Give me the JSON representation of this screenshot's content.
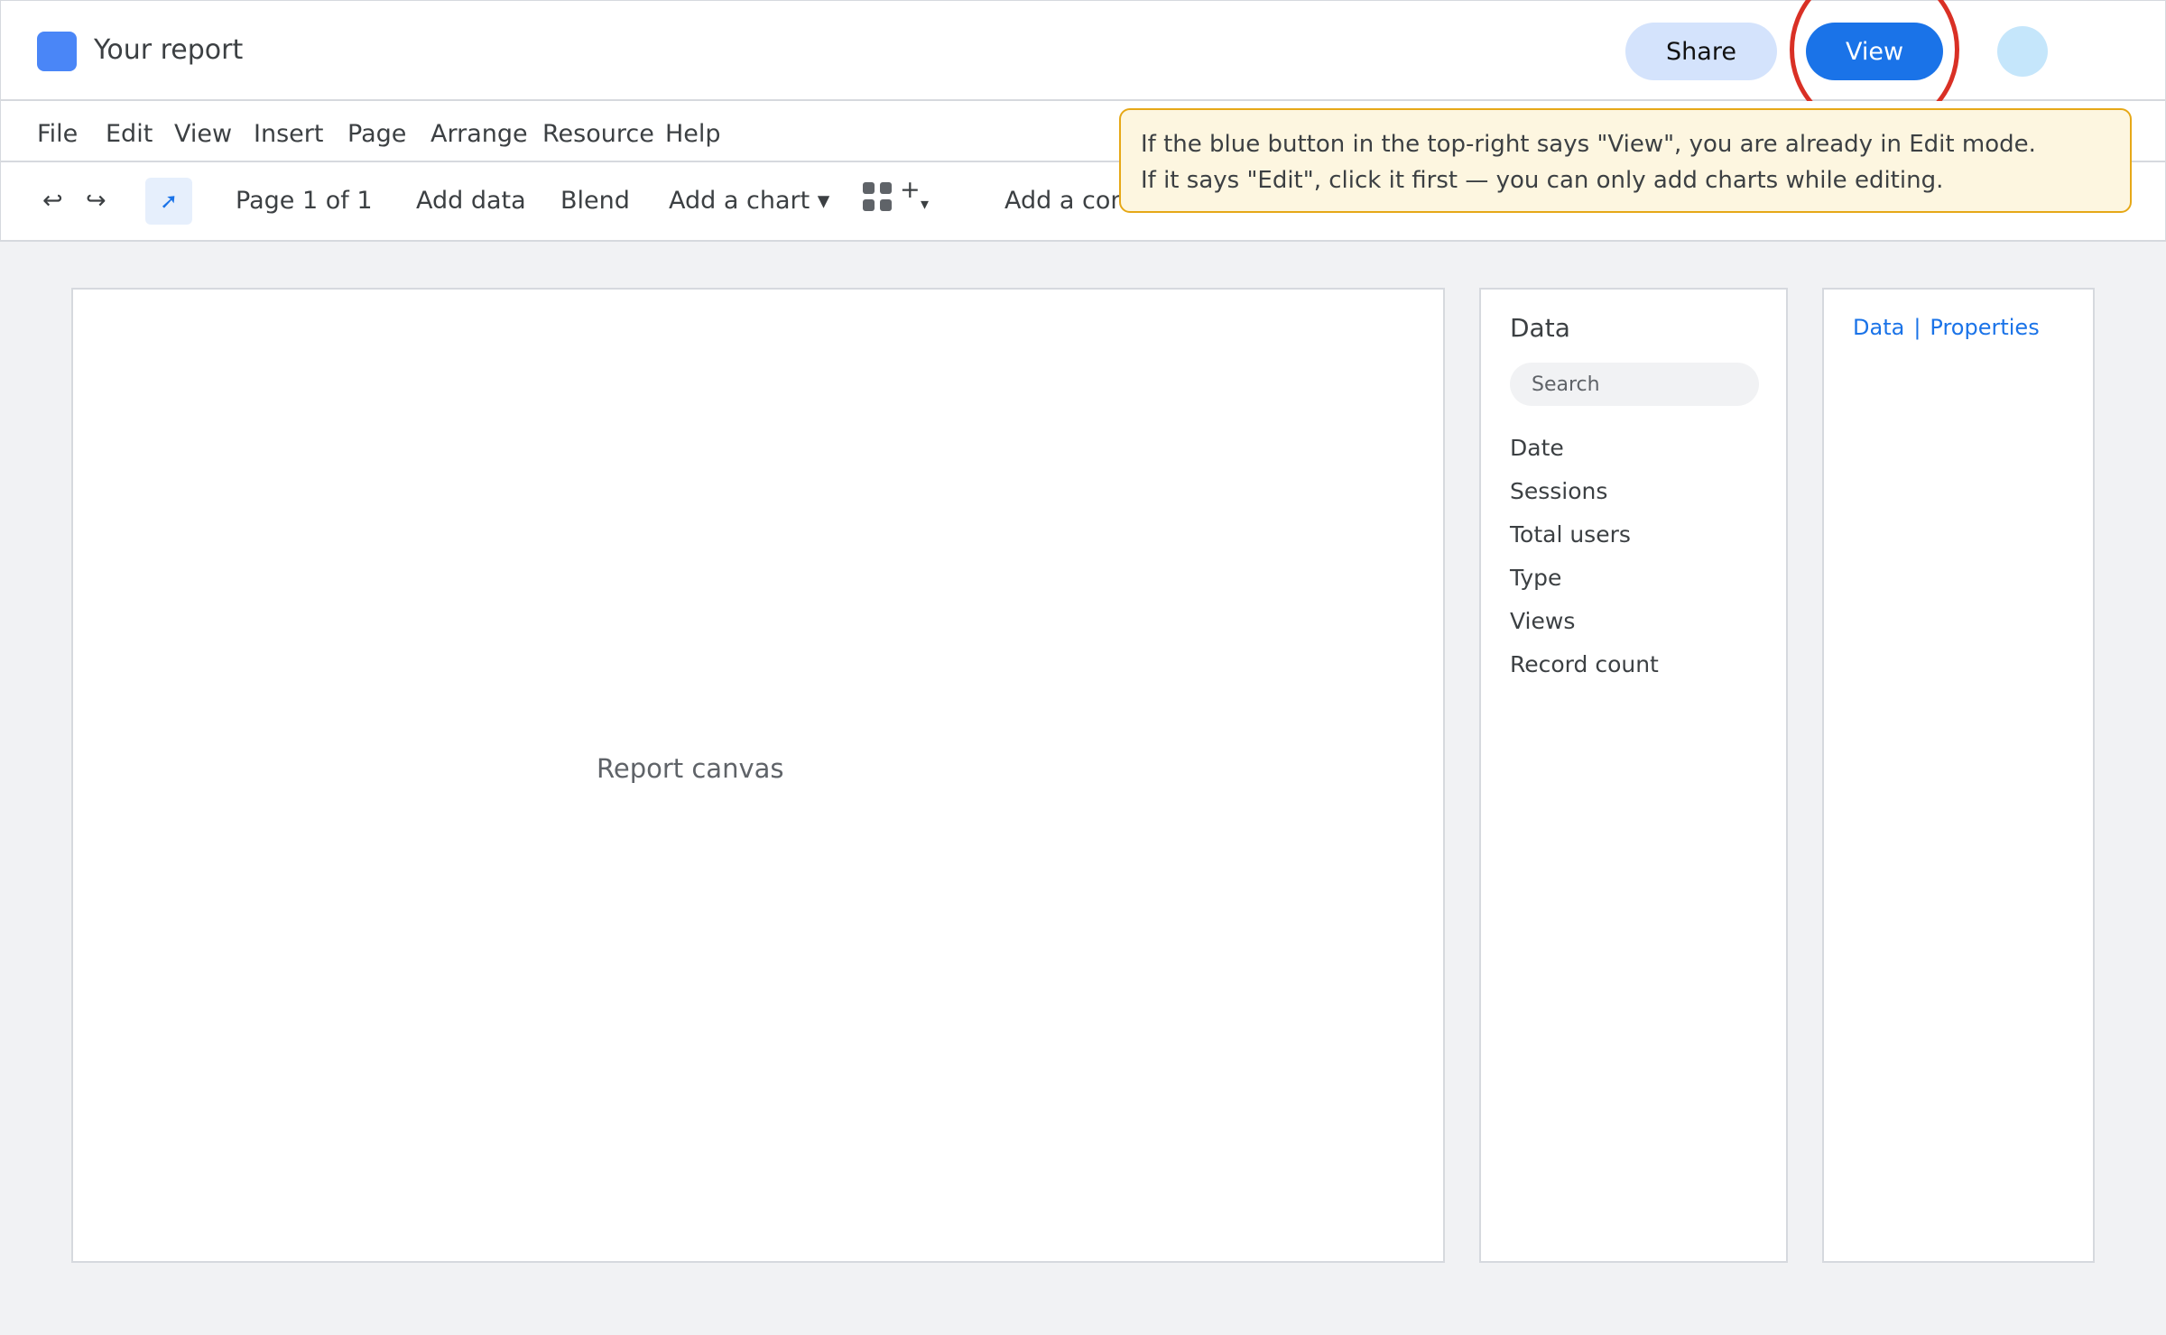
{
  "header": {
    "title": "Your report",
    "share_label": "Share",
    "mode_button_label": "View",
    "accent_color": "#1a73e8",
    "highlight_color": "#d93025"
  },
  "menu": [
    "File",
    "Edit",
    "View",
    "Insert",
    "Page",
    "Arrange",
    "Resource",
    "Help"
  ],
  "toolbar": {
    "undo_icon": "↩",
    "redo_icon": "↪",
    "select_icon": "➚",
    "page_indicator": "Page 1 of 1",
    "add_data": "Add data",
    "blend": "Blend",
    "add_chart": "Add a chart ▾",
    "community_plus": "+",
    "community_caret": "▾",
    "add_control_partial": "Add a con"
  },
  "callout": {
    "line1": "If the blue button in the top-right says \"View\", you are already in Edit mode.",
    "line2": "If it says \"Edit\", click it first — you can only add charts while editing."
  },
  "canvas": {
    "label": "Report canvas"
  },
  "data_panel": {
    "title": "Data",
    "search_placeholder": "Search",
    "fields": [
      "Date",
      "Sessions",
      "Total users",
      "Type",
      "Views",
      "Record count"
    ]
  },
  "properties_panel": {
    "tab_data": "Data",
    "separator": "|",
    "tab_properties": "Properties"
  }
}
